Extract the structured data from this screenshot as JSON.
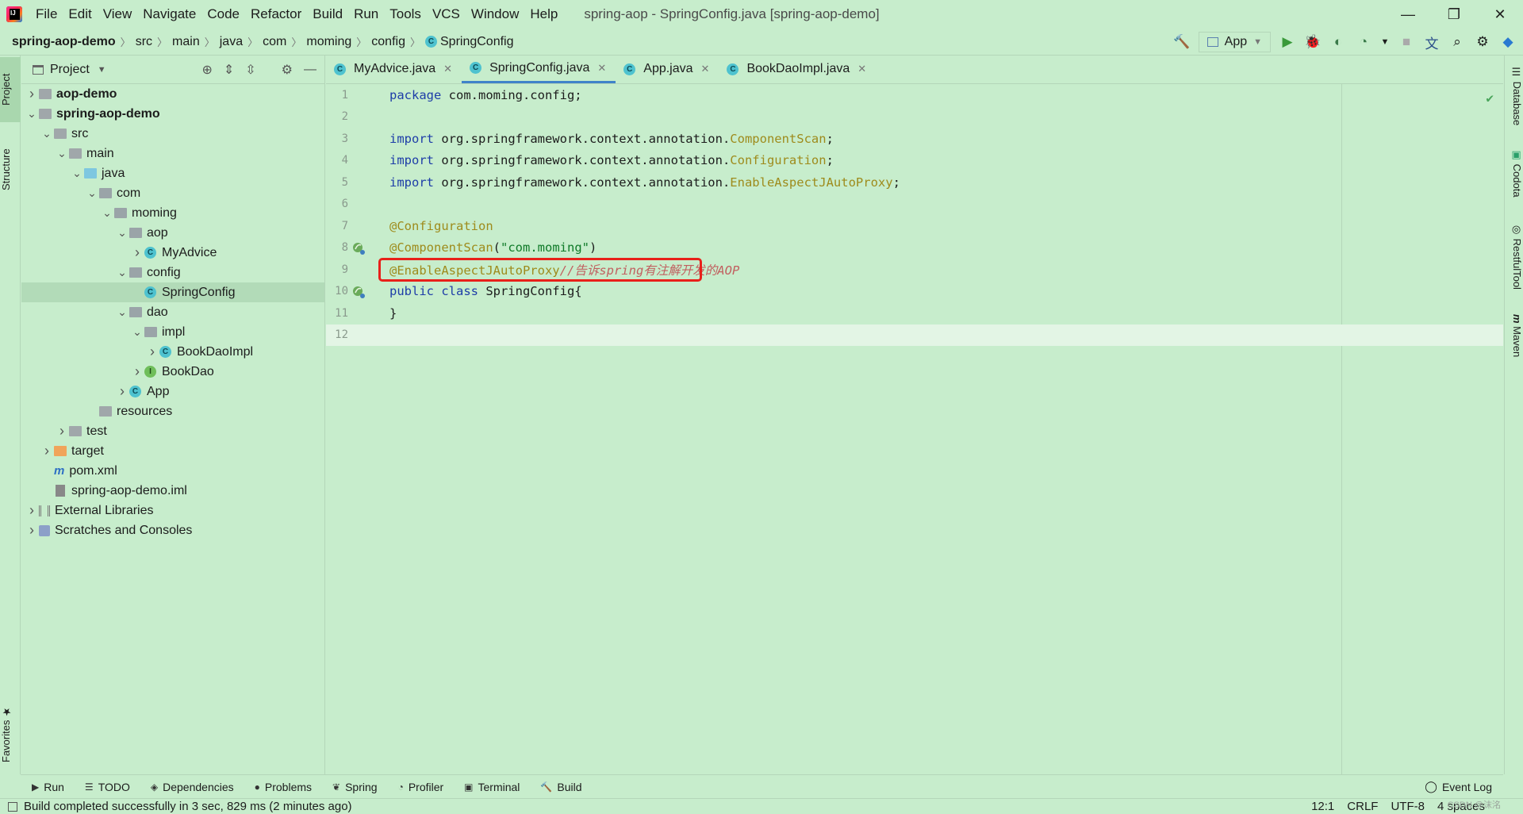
{
  "window": {
    "title": "spring-aop - SpringConfig.java [spring-aop-demo]",
    "menu": [
      "File",
      "Edit",
      "View",
      "Navigate",
      "Code",
      "Refactor",
      "Build",
      "Run",
      "Tools",
      "VCS",
      "Window",
      "Help"
    ],
    "controls": {
      "minimize": "—",
      "restore": "❐",
      "close": "✕"
    }
  },
  "breadcrumb": [
    "spring-aop-demo",
    "src",
    "main",
    "java",
    "com",
    "moming",
    "config",
    "SpringConfig"
  ],
  "toolbar": {
    "run_config": "App"
  },
  "left_strip": {
    "project": "Project",
    "structure": "Structure",
    "favorites": "Favorites"
  },
  "right_strip": {
    "database": "Database",
    "codota": "Codota",
    "restful": "RestfulTool",
    "maven": "Maven"
  },
  "project_panel": {
    "title": "Project",
    "tree": [
      {
        "label": "aop-demo",
        "depth": 0,
        "icon": "module",
        "expanded": false,
        "bold": true
      },
      {
        "label": "spring-aop-demo",
        "depth": 0,
        "icon": "module",
        "expanded": true,
        "bold": true
      },
      {
        "label": "src",
        "depth": 1,
        "icon": "folder",
        "expanded": true
      },
      {
        "label": "main",
        "depth": 2,
        "icon": "folder",
        "expanded": true
      },
      {
        "label": "java",
        "depth": 3,
        "icon": "src",
        "expanded": true
      },
      {
        "label": "com",
        "depth": 4,
        "icon": "package",
        "expanded": true
      },
      {
        "label": "moming",
        "depth": 5,
        "icon": "package",
        "expanded": true
      },
      {
        "label": "aop",
        "depth": 6,
        "icon": "package",
        "expanded": true
      },
      {
        "label": "MyAdvice",
        "depth": 7,
        "icon": "class",
        "expanded": false
      },
      {
        "label": "config",
        "depth": 6,
        "icon": "package",
        "expanded": true
      },
      {
        "label": "SpringConfig",
        "depth": 7,
        "icon": "class",
        "leaf": true,
        "selected": true
      },
      {
        "label": "dao",
        "depth": 6,
        "icon": "package",
        "expanded": true
      },
      {
        "label": "impl",
        "depth": 7,
        "icon": "package",
        "expanded": true
      },
      {
        "label": "BookDaoImpl",
        "depth": 8,
        "icon": "class",
        "expanded": false
      },
      {
        "label": "BookDao",
        "depth": 7,
        "icon": "interface",
        "expanded": false
      },
      {
        "label": "App",
        "depth": 6,
        "icon": "class",
        "expanded": false
      },
      {
        "label": "resources",
        "depth": 4,
        "icon": "resources",
        "leaf": true
      },
      {
        "label": "test",
        "depth": 2,
        "icon": "folder",
        "expanded": false
      },
      {
        "label": "target",
        "depth": 1,
        "icon": "orange",
        "expanded": false
      },
      {
        "label": "pom.xml",
        "depth": 1,
        "icon": "maven",
        "leaf": true
      },
      {
        "label": "spring-aop-demo.iml",
        "depth": 1,
        "icon": "file",
        "leaf": true
      },
      {
        "label": "External Libraries",
        "depth": 0,
        "icon": "library",
        "expanded": false
      },
      {
        "label": "Scratches and Consoles",
        "depth": 0,
        "icon": "scratch",
        "expanded": false
      }
    ]
  },
  "tabs": [
    {
      "label": "MyAdvice.java",
      "active": false
    },
    {
      "label": "SpringConfig.java",
      "active": true
    },
    {
      "label": "App.java",
      "active": false
    },
    {
      "label": "BookDaoImpl.java",
      "active": false
    }
  ],
  "editor": {
    "lines": [
      {
        "n": "1",
        "parts": [
          [
            "kw",
            "package"
          ],
          [
            "p",
            " com.moming.config;"
          ]
        ]
      },
      {
        "n": "2",
        "parts": []
      },
      {
        "n": "3",
        "parts": [
          [
            "kw",
            "import"
          ],
          [
            "p",
            " org.springframework.context.annotation."
          ],
          [
            "an",
            "ComponentScan"
          ],
          [
            "p",
            ";"
          ]
        ]
      },
      {
        "n": "4",
        "parts": [
          [
            "kw",
            "import"
          ],
          [
            "p",
            " org.springframework.context.annotation."
          ],
          [
            "an",
            "Configuration"
          ],
          [
            "p",
            ";"
          ]
        ]
      },
      {
        "n": "5",
        "parts": [
          [
            "kw",
            "import"
          ],
          [
            "p",
            " org.springframework.context.annotation."
          ],
          [
            "an",
            "EnableAspectJAutoProxy"
          ],
          [
            "p",
            ";"
          ]
        ]
      },
      {
        "n": "6",
        "parts": []
      },
      {
        "n": "7",
        "parts": [
          [
            "an",
            "@Configuration"
          ]
        ]
      },
      {
        "n": "8",
        "parts": [
          [
            "an",
            "@ComponentScan"
          ],
          [
            "p",
            "("
          ],
          [
            "str",
            "\"com.moming\""
          ],
          [
            "p",
            ")"
          ]
        ]
      },
      {
        "n": "9",
        "parts": [
          [
            "an",
            "@EnableAspectJAutoProxy"
          ],
          [
            "cm",
            "//告诉spring有注解开发的AOP"
          ]
        ]
      },
      {
        "n": "10",
        "parts": [
          [
            "kw",
            "public class"
          ],
          [
            "p",
            " SpringConfig{"
          ]
        ]
      },
      {
        "n": "11",
        "parts": [
          [
            "p",
            "}"
          ]
        ]
      },
      {
        "n": "12",
        "parts": []
      }
    ]
  },
  "tool_windows": [
    "Run",
    "TODO",
    "Dependencies",
    "Problems",
    "Spring",
    "Profiler",
    "Terminal",
    "Build"
  ],
  "event_log": "Event Log",
  "status": {
    "message": "Build completed successfully in 3 sec, 829 ms (2 minutes ago)",
    "position": "12:1",
    "line_sep": "CRLF",
    "encoding": "UTF-8",
    "indent": "4 spaces"
  },
  "watermark": "CSDN @沫洺"
}
